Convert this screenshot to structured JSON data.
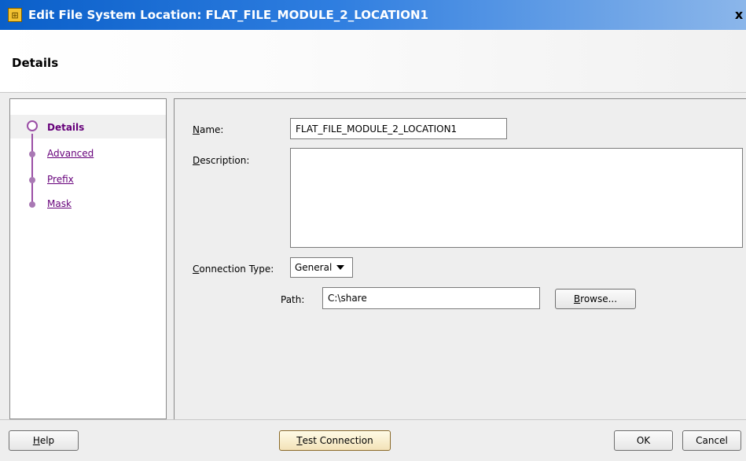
{
  "window": {
    "title": "Edit File System Location: FLAT_FILE_MODULE_2_LOCATION1",
    "icon": "dialog-app-icon",
    "close_glyph": "x"
  },
  "header": {
    "title": "Details"
  },
  "steps": [
    {
      "label": "Details",
      "current": true
    },
    {
      "label": "Advanced",
      "current": false
    },
    {
      "label": "Prefix",
      "current": false
    },
    {
      "label": "Mask",
      "current": false
    }
  ],
  "form": {
    "name_label_mn": "N",
    "name_label_rest": "ame:",
    "name_value": "FLAT_FILE_MODULE_2_LOCATION1",
    "description_label_mn": "D",
    "description_label_rest": "escription:",
    "description_value": "",
    "connection_type_label_mn": "C",
    "connection_type_label_rest": "onnection Type:",
    "connection_type_value": "General",
    "path_label": "Path:",
    "path_value": "C:\\share",
    "browse_label_mn": "B",
    "browse_label_rest": "rowse..."
  },
  "footer": {
    "help_label_mn": "H",
    "help_label_rest": "elp",
    "test_connection_label_mn": "T",
    "test_connection_label_rest": "est Connection",
    "ok_label": "OK",
    "cancel_label": "Cancel"
  },
  "colors": {
    "titlebar_start": "#0a5fc9",
    "titlebar_end": "#8bb6ea",
    "step_accent": "#9b4fa6",
    "step_link": "#66007a"
  }
}
